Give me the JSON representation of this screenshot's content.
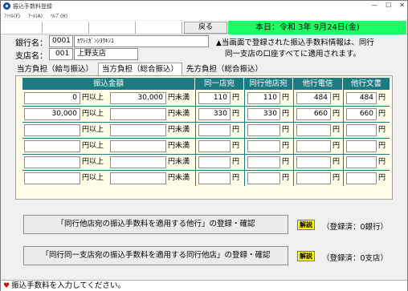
{
  "window": {
    "title": "振込手数料登録",
    "controls": [
      "—",
      "☐",
      "✕"
    ]
  },
  "menu": [
    "ﾌｧｲﾙ(F)",
    "ｱｰﾙ(A)",
    "ﾍﾙﾌﾟ(H)"
  ],
  "toolbar": {
    "back_label": "戻る",
    "date_text": "本日：令和  3年  9月24日(金)"
  },
  "bank": {
    "name_label": "銀行名：",
    "code": "0001",
    "name": "ｶﾜｼﾐｶﾞﾝｼﾖｳｷﾝｺ",
    "branch_label": "支店名：",
    "branch_code": "001",
    "branch_name": "上野支店"
  },
  "notice": {
    "line1": "当画面で登録された振込手数料情報は、同行",
    "line2": "同一支店の口座すべてに適用されます。"
  },
  "tabs": [
    "当方負担（給与振込）",
    "当方負担（総合振込）",
    "先方負担（総合振込）"
  ],
  "table": {
    "headers": [
      "振込金額",
      "同一店宛",
      "同行他店宛",
      "他行電信",
      "他行文書"
    ],
    "unit_yen": "円",
    "label_min": "円以上",
    "label_max": "円未満",
    "rows": [
      {
        "min": "0",
        "max": "30,000",
        "same_branch": "110",
        "same_bank": "110",
        "other_wire": "484",
        "other_doc": "484"
      },
      {
        "min": "30,000",
        "max": "",
        "same_branch": "330",
        "same_bank": "330",
        "other_wire": "660",
        "other_doc": "660"
      },
      {
        "min": "",
        "max": "",
        "same_branch": "",
        "same_bank": "",
        "other_wire": "",
        "other_doc": ""
      },
      {
        "min": "",
        "max": "",
        "same_branch": "",
        "same_bank": "",
        "other_wire": "",
        "other_doc": ""
      },
      {
        "min": "",
        "max": "",
        "same_branch": "",
        "same_bank": "",
        "other_wire": "",
        "other_doc": ""
      },
      {
        "min": "",
        "max": "",
        "same_branch": "",
        "same_bank": "",
        "other_wire": "",
        "other_doc": ""
      }
    ]
  },
  "actions": {
    "other_bank_label": "「同行他店宛の振込手数料を適用する他行」の登録・確認",
    "other_bank_status": "（登録済：0銀行）",
    "same_bank_label": "「同行同一支店宛の振込手数料を適用する同行他店」の登録・確認",
    "same_bank_status": "（登録済：0支店）",
    "kaisetsu_label": "解説"
  },
  "status": {
    "message": "振込手数料を入力してください。"
  },
  "colors": {
    "header_teal": "#1d7b83",
    "date_green": "#1aff66",
    "panel_cream": "#fffde8",
    "kaisetsu_yellow": "#ffff00"
  }
}
